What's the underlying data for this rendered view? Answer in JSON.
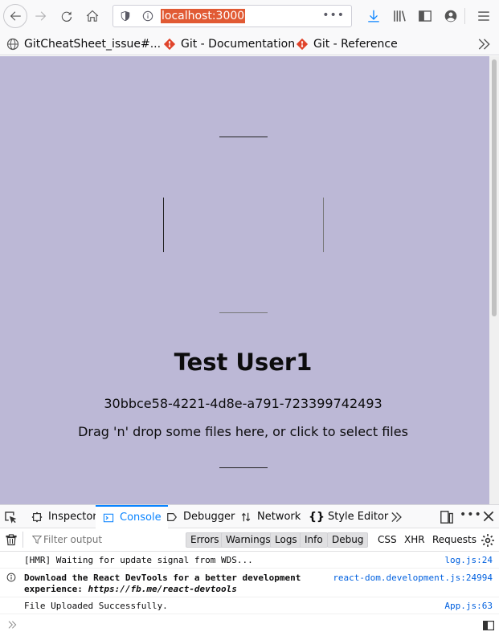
{
  "browser": {
    "url": "localhost:3000",
    "bookmarks": [
      {
        "label": "GitCheatSheet_issue#..."
      },
      {
        "label": "Git - Documentation"
      },
      {
        "label": "Git - Reference"
      }
    ]
  },
  "page": {
    "user_name": "Test User1",
    "user_id": "30bbce58-4221-4d8e-a791-723399742493",
    "dropzone_text": "Drag 'n' drop some files here, or click to select files",
    "background_color": "#bcb8d6"
  },
  "devtools": {
    "tabs": [
      {
        "label": "Inspector"
      },
      {
        "label": "Console"
      },
      {
        "label": "Debugger"
      },
      {
        "label": "Network"
      },
      {
        "label": "Style Editor"
      }
    ],
    "active_tab": "Console",
    "filter_placeholder": "Filter output",
    "levels": [
      "Errors",
      "Warnings",
      "Logs",
      "Info",
      "Debug"
    ],
    "types": [
      "CSS",
      "XHR",
      "Requests"
    ],
    "messages": [
      {
        "text": "[HMR] Waiting for update signal from WDS...",
        "source": "log.js:24"
      },
      {
        "text_line1": "Download the React DevTools for a better development",
        "text_line2_prefix": "experience: ",
        "text_line2_link": "https://fb.me/react-devtools",
        "source": "react-dom.development.js:24994"
      },
      {
        "text": "File Uploaded Successfully.",
        "source": "App.js:63"
      }
    ]
  }
}
